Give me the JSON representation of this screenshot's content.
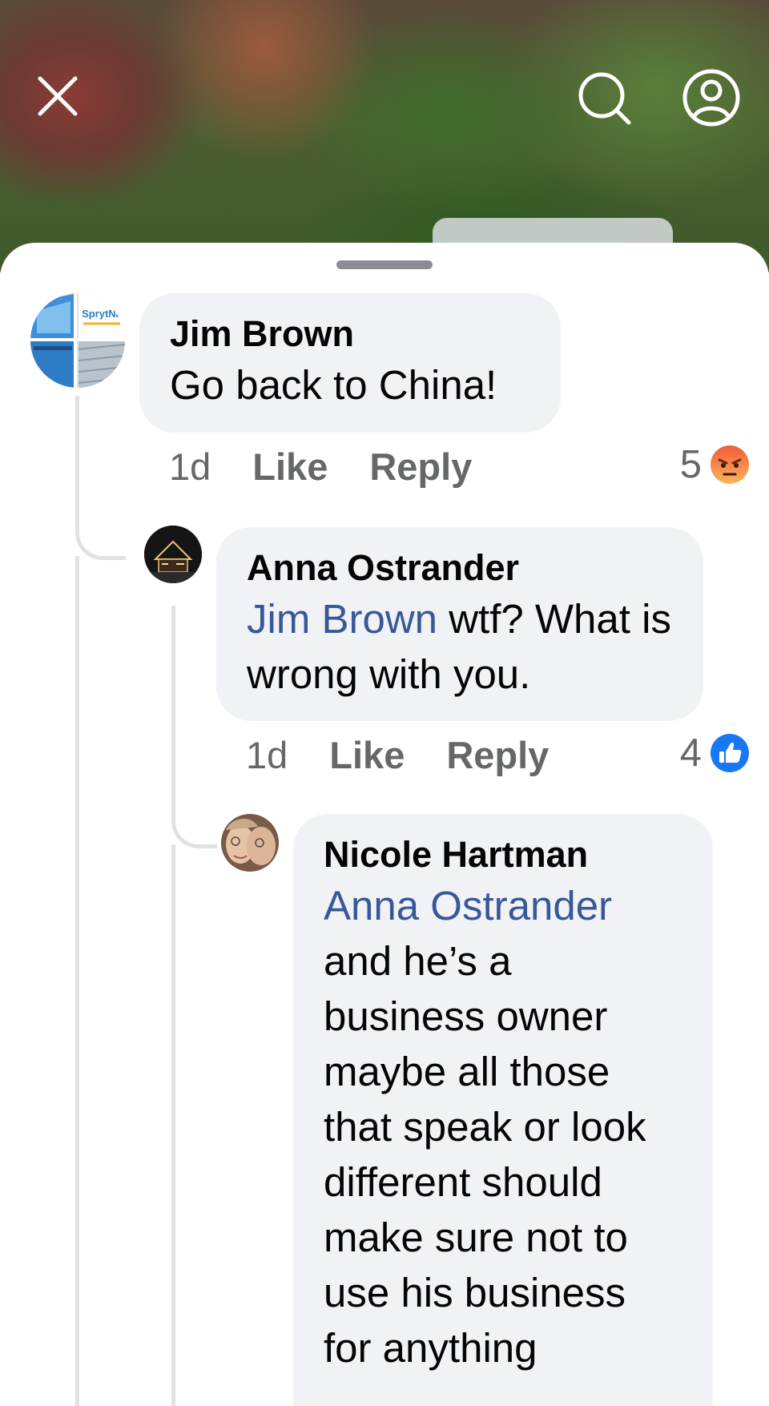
{
  "header": {
    "close_icon": "close-icon",
    "search_icon": "search-icon",
    "profile_icon": "profile-icon"
  },
  "comments": [
    {
      "author": "Jim Brown",
      "mention": "",
      "text": "Go back to China!",
      "time": "1d",
      "like_label": "Like",
      "reply_label": "Reply",
      "reaction_count": "5",
      "reaction_icon": "angry-reaction-icon",
      "avatar_logo_text": "SprytNa"
    },
    {
      "author": "Anna Ostrander",
      "mention": "Jim Brown",
      "text": " wtf? What is wrong with you.",
      "time": "1d",
      "like_label": "Like",
      "reply_label": "Reply",
      "reaction_count": "4",
      "reaction_icon": "like-reaction-icon"
    },
    {
      "author": "Nicole Hartman",
      "mention": "Anna Ostrander",
      "text": "and he’s a business owner maybe all those that speak or look different should make sure not to use his business for anything"
    }
  ],
  "colors": {
    "mention": "#385898",
    "bubble": "#f0f2f5",
    "meta": "#65676b",
    "like_blue": "#1877f2",
    "angry_orange": "#f7714c"
  }
}
